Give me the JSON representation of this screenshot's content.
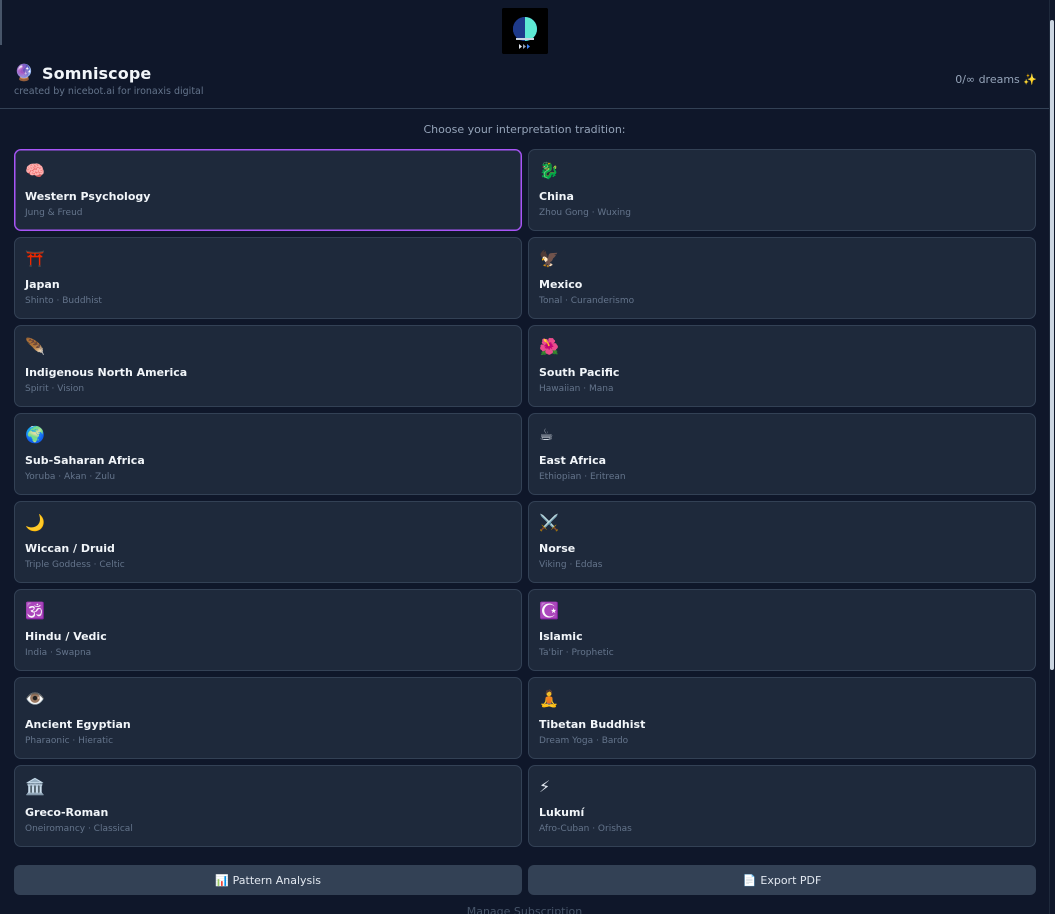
{
  "header": {
    "icon": "crystal-ball-icon",
    "icon_glyph": "🔮",
    "title": "Somniscope",
    "credit": "created by nicebot.ai for ironaxis digital",
    "dream_count": "0/∞ dreams",
    "dream_spark": "✨"
  },
  "prompt": "Choose your interpretation tradition:",
  "traditions": [
    {
      "icon": "🧠",
      "icon_name": "brain-icon",
      "title": "Western Psychology",
      "subtitle": "Jung & Freud",
      "selected": true
    },
    {
      "icon": "🐉",
      "icon_name": "dragon-icon",
      "title": "China",
      "subtitle": "Zhou Gong · Wuxing",
      "selected": false
    },
    {
      "icon": "⛩️",
      "icon_name": "torii-gate-icon",
      "title": "Japan",
      "subtitle": "Shinto · Buddhist",
      "selected": false
    },
    {
      "icon": "🦅",
      "icon_name": "eagle-icon",
      "title": "Mexico",
      "subtitle": "Tonal · Curanderismo",
      "selected": false
    },
    {
      "icon": "🪶",
      "icon_name": "feather-icon",
      "title": "Indigenous North America",
      "subtitle": "Spirit · Vision",
      "selected": false
    },
    {
      "icon": "🌺",
      "icon_name": "hibiscus-icon",
      "title": "South Pacific",
      "subtitle": "Hawaiian · Mana",
      "selected": false
    },
    {
      "icon": "🌍",
      "icon_name": "globe-africa-icon",
      "title": "Sub-Saharan Africa",
      "subtitle": "Yoruba · Akan · Zulu",
      "selected": false
    },
    {
      "icon": "☕",
      "icon_name": "coffee-icon",
      "title": "East Africa",
      "subtitle": "Ethiopian · Eritrean",
      "selected": false
    },
    {
      "icon": "🌙",
      "icon_name": "crescent-moon-icon",
      "title": "Wiccan / Druid",
      "subtitle": "Triple Goddess · Celtic",
      "selected": false
    },
    {
      "icon": "⚔️",
      "icon_name": "crossed-swords-icon",
      "title": "Norse",
      "subtitle": "Viking · Eddas",
      "selected": false
    },
    {
      "icon": "🕉️",
      "icon_name": "om-icon",
      "title": "Hindu / Vedic",
      "subtitle": "India · Swapna",
      "selected": false
    },
    {
      "icon": "☪️",
      "icon_name": "star-crescent-icon",
      "title": "Islamic",
      "subtitle": "Ta'bir · Prophetic",
      "selected": false
    },
    {
      "icon": "👁️",
      "icon_name": "eye-icon",
      "title": "Ancient Egyptian",
      "subtitle": "Pharaonic · Hieratic",
      "selected": false
    },
    {
      "icon": "🧘",
      "icon_name": "meditation-icon",
      "title": "Tibetan Buddhist",
      "subtitle": "Dream Yoga · Bardo",
      "selected": false
    },
    {
      "icon": "🏛️",
      "icon_name": "classical-building-icon",
      "title": "Greco-Roman",
      "subtitle": "Oneiromancy · Classical",
      "selected": false
    },
    {
      "icon": "⚡",
      "icon_name": "lightning-icon",
      "title": "Lukumí",
      "subtitle": "Afro-Cuban · Orishas",
      "selected": false
    }
  ],
  "actions": {
    "pattern_icon": "📊",
    "pattern_label": "Pattern Analysis",
    "export_icon": "📄",
    "export_label": "Export PDF"
  },
  "peek_text": "Manage Subscription"
}
